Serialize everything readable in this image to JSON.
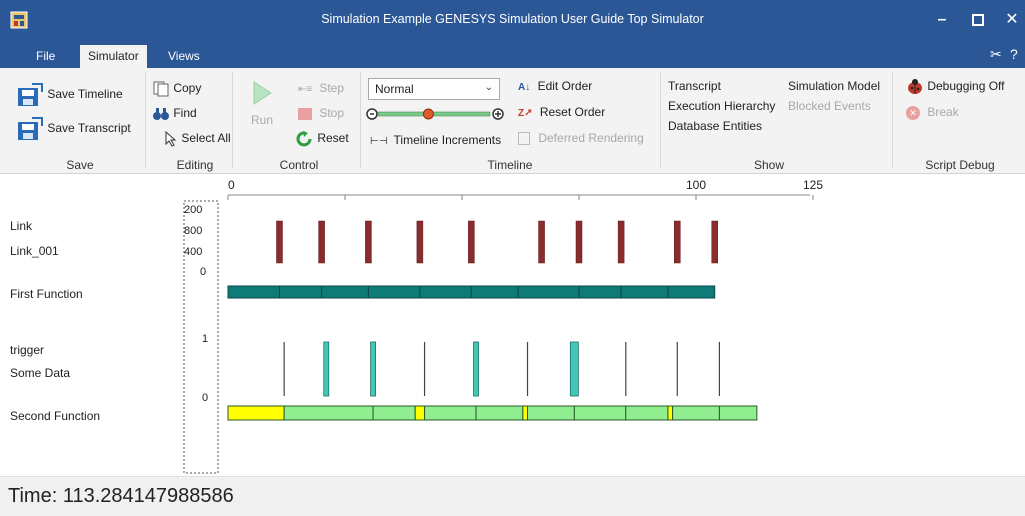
{
  "window": {
    "title": "Simulation Example GENESYS Simulation User Guide Top Simulator",
    "min_icon": "minimize-icon",
    "max_icon": "maximize-icon",
    "close_icon": "close-icon"
  },
  "tabs": [
    {
      "label": "File",
      "active": false
    },
    {
      "label": "Simulator",
      "active": true
    },
    {
      "label": "Views",
      "active": false
    }
  ],
  "ribbon": {
    "save": {
      "label": "Save",
      "save_timeline": "Save Timeline",
      "save_transcript": "Save Transcript"
    },
    "editing": {
      "label": "Editing",
      "copy": "Copy",
      "find": "Find",
      "select_all": "Select All"
    },
    "control": {
      "label": "Control",
      "run": "Run",
      "step": "Step",
      "stop": "Stop",
      "reset": "Reset"
    },
    "timeline": {
      "label": "Timeline",
      "speed_value": "Normal",
      "slider_level": 0.45,
      "timeline_increments": "Timeline Increments",
      "edit_order": "Edit Order",
      "reset_order": "Reset Order",
      "deferred_rendering": "Deferred Rendering"
    },
    "show": {
      "label": "Show",
      "transcript": "Transcript",
      "execution_hierarchy": "Execution Hierarchy",
      "database_entities": "Database Entities",
      "simulation_model": "Simulation Model",
      "blocked_events": "Blocked Events"
    },
    "script_debug": {
      "label": "Script Debug",
      "debugging_off": "Debugging Off",
      "break": "Break"
    }
  },
  "timeline": {
    "axis_ticks": [
      {
        "value": 0,
        "label": "0"
      },
      {
        "value": 100,
        "label": "100"
      },
      {
        "value": 125,
        "label": "125"
      }
    ],
    "left_axis_labels": [
      "200",
      "800",
      "400",
      "0"
    ],
    "trigger_axis_labels": [
      "1",
      "0"
    ],
    "rows": [
      {
        "name": "Link"
      },
      {
        "name": "Link_001"
      },
      {
        "name": "First Function"
      },
      {
        "name": "trigger"
      },
      {
        "name": "Some Data"
      },
      {
        "name": "Second Function"
      }
    ],
    "link_events": [
      11,
      20,
      30,
      41,
      52,
      67,
      75,
      84,
      96,
      104
    ],
    "first_function_segments": [
      0,
      11,
      20,
      30,
      41,
      52,
      62,
      75,
      84,
      94,
      104
    ],
    "trigger_events": [
      {
        "t": 12,
        "data": false
      },
      {
        "t": 21,
        "data": true
      },
      {
        "t": 31,
        "data": true
      },
      {
        "t": 42,
        "data": false
      },
      {
        "t": 53,
        "data": true
      },
      {
        "t": 64,
        "data": false
      },
      {
        "t": 74,
        "data": true,
        "wide": true
      },
      {
        "t": 85,
        "data": false
      },
      {
        "t": 96,
        "data": false
      },
      {
        "t": 105,
        "data": false
      }
    ],
    "second_function_segments": [
      {
        "start": 0,
        "end": 12,
        "color": "#ffff00"
      },
      {
        "start": 12,
        "end": 31,
        "color": "#90ee90"
      },
      {
        "start": 31,
        "end": 40,
        "color": "#90ee90"
      },
      {
        "start": 40,
        "end": 42,
        "color": "#ffff00"
      },
      {
        "start": 42,
        "end": 53,
        "color": "#90ee90"
      },
      {
        "start": 53,
        "end": 63,
        "color": "#90ee90"
      },
      {
        "start": 63,
        "end": 64,
        "color": "#ffff00"
      },
      {
        "start": 64,
        "end": 74,
        "color": "#90ee90"
      },
      {
        "start": 74,
        "end": 85,
        "color": "#90ee90"
      },
      {
        "start": 85,
        "end": 94,
        "color": "#90ee90"
      },
      {
        "start": 94,
        "end": 95,
        "color": "#ffff00"
      },
      {
        "start": 95,
        "end": 105,
        "color": "#90ee90"
      },
      {
        "start": 105,
        "end": 113,
        "color": "#90ee90"
      }
    ],
    "colors": {
      "link_bar": "#8b2b2b",
      "first_function": "#0f7b77",
      "trigger_line": "#444444",
      "data_bar": "#40c8b8"
    }
  },
  "status": {
    "time_text": "Time: 113.284147988586"
  }
}
